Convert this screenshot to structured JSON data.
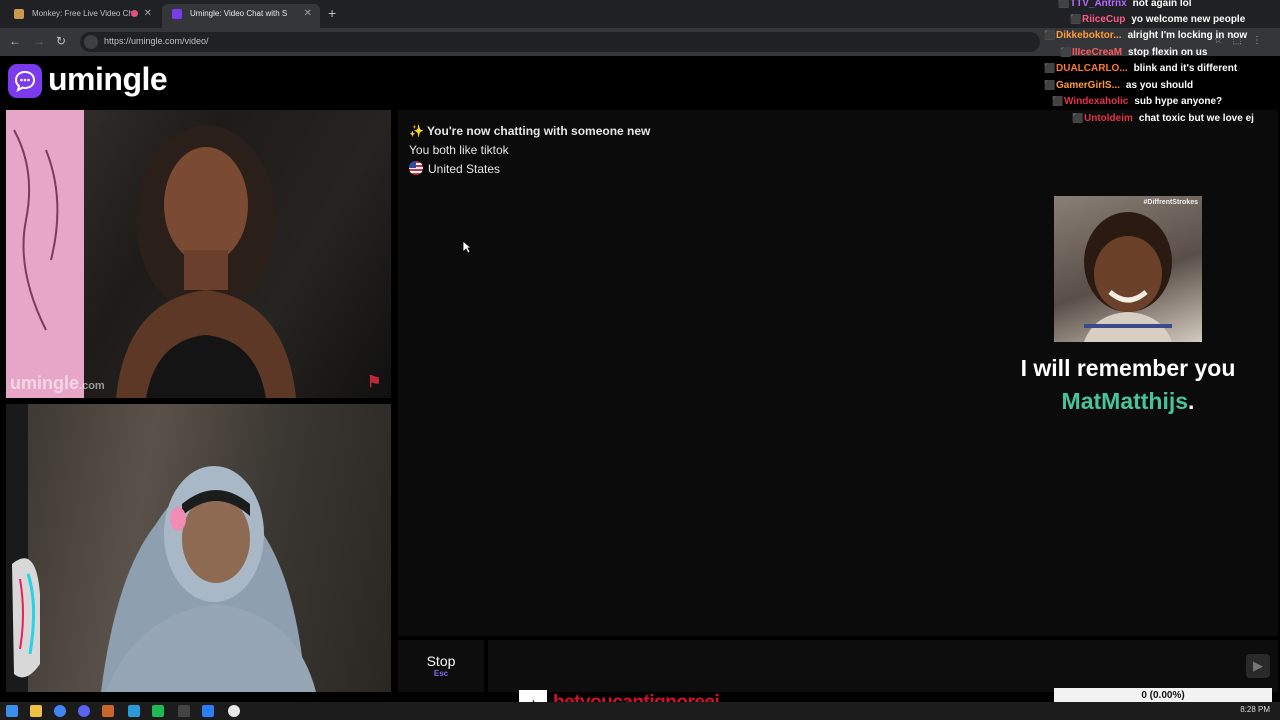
{
  "browser": {
    "tabs": [
      {
        "title": "Monkey: Free Live Video Ch",
        "active": false
      },
      {
        "title": "Umingle: Video Chat with S",
        "active": true
      }
    ],
    "url": "https://umingle.com/video/"
  },
  "site": {
    "logo_text": "umingle",
    "watermark_main": "umingle",
    "watermark_suffix": ".com"
  },
  "chat": {
    "intro": "✨ You're now chatting with someone new",
    "interest": "You both like tiktok",
    "country": "United States"
  },
  "controls": {
    "stop_label": "Stop",
    "stop_key": "Esc",
    "send_icon": "▶"
  },
  "overlay": {
    "meme_tag": "#DiffrentStrokes",
    "line1": "I will remember you",
    "username": "MatMatthijs",
    "period": ".",
    "tiktok_handle": "betyoucantignoreej",
    "goal_value": "0 (0.00%)"
  },
  "stream_chat": [
    {
      "user": "TTV_Antrnx",
      "color": "#b26bff",
      "msg": "not again lol"
    },
    {
      "user": "RiiceCup",
      "color": "#ff5a8a",
      "msg": "yo welcome new people"
    },
    {
      "user": "Dikkeboktor...",
      "color": "#ff9c3a",
      "msg": "alright I'm locking in now"
    },
    {
      "user": "IIIceCreaM",
      "color": "#ff5a5a",
      "msg": "stop flexin on us"
    },
    {
      "user": "DUALCARLO...",
      "color": "#ff7a2e",
      "msg": "blink and it's different"
    },
    {
      "user": "GamerGirlS...",
      "color": "#ff9c3a",
      "msg": "as you should"
    },
    {
      "user": "Windexaholic",
      "color": "#e2334b",
      "msg": "sub hype anyone?"
    },
    {
      "user": "Untoldeim",
      "color": "#e2334b",
      "msg": "chat toxic but we love ej"
    }
  ],
  "colors": {
    "brand": "#7c3aed",
    "username_highlight": "#46c59a",
    "kick_badge": "#53fc18"
  },
  "taskbar": {
    "time": "8:28 PM"
  }
}
